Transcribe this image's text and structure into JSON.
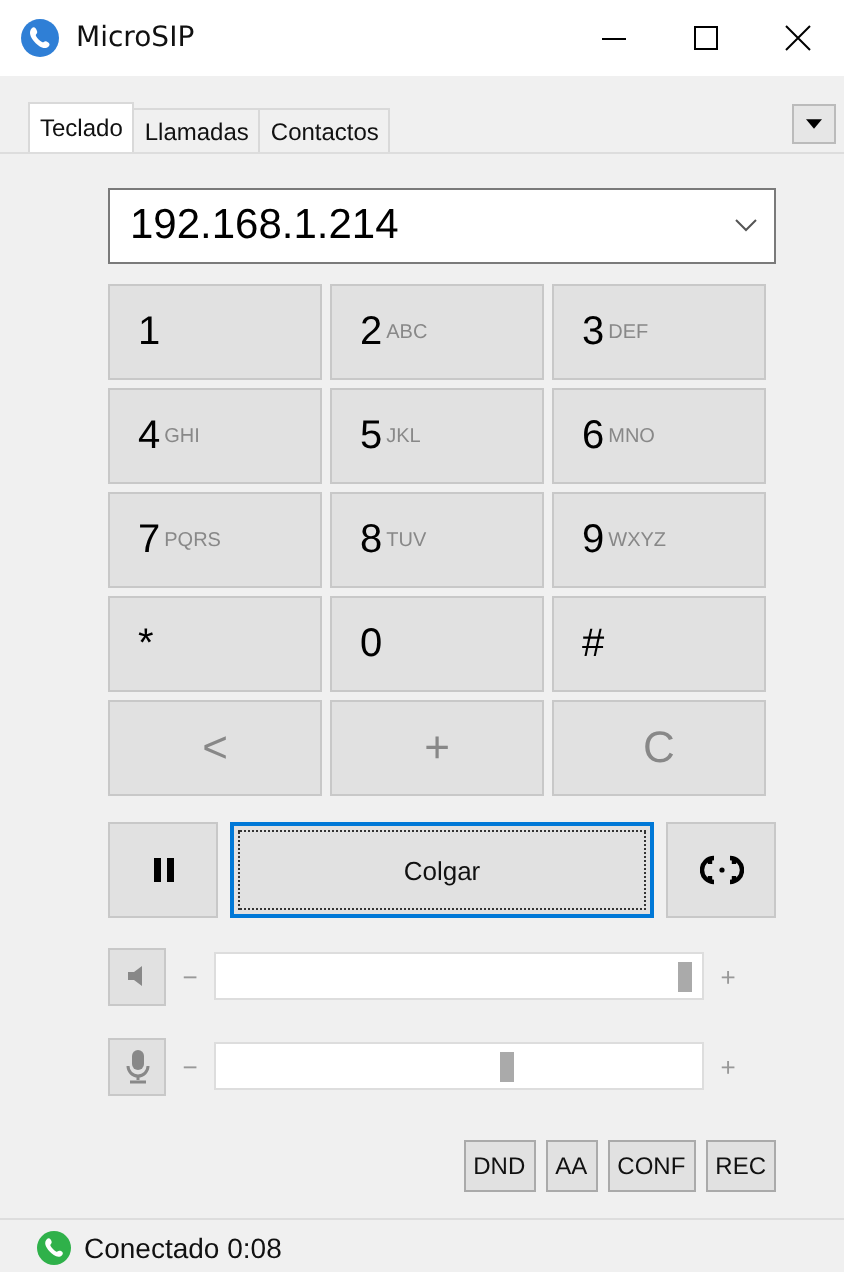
{
  "window": {
    "title": "MicroSIP"
  },
  "tabs": [
    {
      "label": "Teclado",
      "selected": true
    },
    {
      "label": "Llamadas",
      "selected": false
    },
    {
      "label": "Contactos",
      "selected": false
    }
  ],
  "dial_field": {
    "value": "192.168.1.214"
  },
  "keypad": [
    {
      "kind": "digit",
      "main": "1"
    },
    {
      "kind": "digit",
      "main": "2",
      "sub": "ABC"
    },
    {
      "kind": "digit",
      "main": "3",
      "sub": "DEF"
    },
    {
      "kind": "digit",
      "main": "4",
      "sub": "GHI"
    },
    {
      "kind": "digit",
      "main": "5",
      "sub": "JKL"
    },
    {
      "kind": "digit",
      "main": "6",
      "sub": "MNO"
    },
    {
      "kind": "digit",
      "main": "7",
      "sub": "PQRS"
    },
    {
      "kind": "digit",
      "main": "8",
      "sub": "TUV"
    },
    {
      "kind": "digit",
      "main": "9",
      "sub": "WXYZ"
    },
    {
      "kind": "digit",
      "main": "*"
    },
    {
      "kind": "digit",
      "main": "0"
    },
    {
      "kind": "digit",
      "main": "#"
    },
    {
      "kind": "action",
      "main": "<"
    },
    {
      "kind": "action",
      "main": "+"
    },
    {
      "kind": "action",
      "main": "C"
    }
  ],
  "call_button": {
    "label": "Colgar"
  },
  "sliders": [
    {
      "kind": "speaker",
      "minus": "−",
      "plus": "+",
      "level": 0.98
    },
    {
      "kind": "microphone",
      "minus": "−",
      "plus": "+",
      "level": 0.6
    }
  ],
  "toggles": [
    "DND",
    "AA",
    "CONF",
    "REC"
  ],
  "status_bar": {
    "text": "Conectado 0:08"
  }
}
